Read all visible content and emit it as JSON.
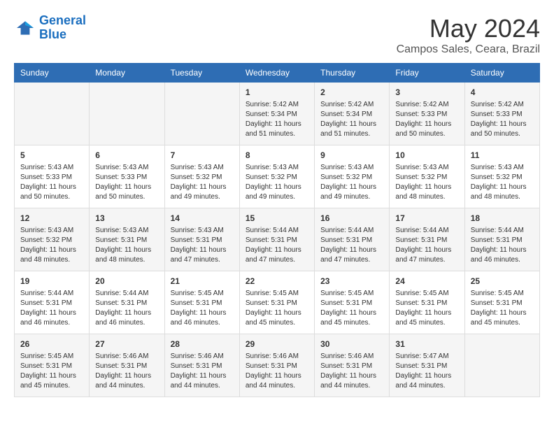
{
  "logo": {
    "line1": "General",
    "line2": "Blue"
  },
  "title": "May 2024",
  "subtitle": "Campos Sales, Ceara, Brazil",
  "days_header": [
    "Sunday",
    "Monday",
    "Tuesday",
    "Wednesday",
    "Thursday",
    "Friday",
    "Saturday"
  ],
  "weeks": [
    [
      {
        "day": "",
        "info": ""
      },
      {
        "day": "",
        "info": ""
      },
      {
        "day": "",
        "info": ""
      },
      {
        "day": "1",
        "info": "Sunrise: 5:42 AM\nSunset: 5:34 PM\nDaylight: 11 hours\nand 51 minutes."
      },
      {
        "day": "2",
        "info": "Sunrise: 5:42 AM\nSunset: 5:34 PM\nDaylight: 11 hours\nand 51 minutes."
      },
      {
        "day": "3",
        "info": "Sunrise: 5:42 AM\nSunset: 5:33 PM\nDaylight: 11 hours\nand 50 minutes."
      },
      {
        "day": "4",
        "info": "Sunrise: 5:42 AM\nSunset: 5:33 PM\nDaylight: 11 hours\nand 50 minutes."
      }
    ],
    [
      {
        "day": "5",
        "info": "Sunrise: 5:43 AM\nSunset: 5:33 PM\nDaylight: 11 hours\nand 50 minutes."
      },
      {
        "day": "6",
        "info": "Sunrise: 5:43 AM\nSunset: 5:33 PM\nDaylight: 11 hours\nand 50 minutes."
      },
      {
        "day": "7",
        "info": "Sunrise: 5:43 AM\nSunset: 5:32 PM\nDaylight: 11 hours\nand 49 minutes."
      },
      {
        "day": "8",
        "info": "Sunrise: 5:43 AM\nSunset: 5:32 PM\nDaylight: 11 hours\nand 49 minutes."
      },
      {
        "day": "9",
        "info": "Sunrise: 5:43 AM\nSunset: 5:32 PM\nDaylight: 11 hours\nand 49 minutes."
      },
      {
        "day": "10",
        "info": "Sunrise: 5:43 AM\nSunset: 5:32 PM\nDaylight: 11 hours\nand 48 minutes."
      },
      {
        "day": "11",
        "info": "Sunrise: 5:43 AM\nSunset: 5:32 PM\nDaylight: 11 hours\nand 48 minutes."
      }
    ],
    [
      {
        "day": "12",
        "info": "Sunrise: 5:43 AM\nSunset: 5:32 PM\nDaylight: 11 hours\nand 48 minutes."
      },
      {
        "day": "13",
        "info": "Sunrise: 5:43 AM\nSunset: 5:31 PM\nDaylight: 11 hours\nand 48 minutes."
      },
      {
        "day": "14",
        "info": "Sunrise: 5:43 AM\nSunset: 5:31 PM\nDaylight: 11 hours\nand 47 minutes."
      },
      {
        "day": "15",
        "info": "Sunrise: 5:44 AM\nSunset: 5:31 PM\nDaylight: 11 hours\nand 47 minutes."
      },
      {
        "day": "16",
        "info": "Sunrise: 5:44 AM\nSunset: 5:31 PM\nDaylight: 11 hours\nand 47 minutes."
      },
      {
        "day": "17",
        "info": "Sunrise: 5:44 AM\nSunset: 5:31 PM\nDaylight: 11 hours\nand 47 minutes."
      },
      {
        "day": "18",
        "info": "Sunrise: 5:44 AM\nSunset: 5:31 PM\nDaylight: 11 hours\nand 46 minutes."
      }
    ],
    [
      {
        "day": "19",
        "info": "Sunrise: 5:44 AM\nSunset: 5:31 PM\nDaylight: 11 hours\nand 46 minutes."
      },
      {
        "day": "20",
        "info": "Sunrise: 5:44 AM\nSunset: 5:31 PM\nDaylight: 11 hours\nand 46 minutes."
      },
      {
        "day": "21",
        "info": "Sunrise: 5:45 AM\nSunset: 5:31 PM\nDaylight: 11 hours\nand 46 minutes."
      },
      {
        "day": "22",
        "info": "Sunrise: 5:45 AM\nSunset: 5:31 PM\nDaylight: 11 hours\nand 45 minutes."
      },
      {
        "day": "23",
        "info": "Sunrise: 5:45 AM\nSunset: 5:31 PM\nDaylight: 11 hours\nand 45 minutes."
      },
      {
        "day": "24",
        "info": "Sunrise: 5:45 AM\nSunset: 5:31 PM\nDaylight: 11 hours\nand 45 minutes."
      },
      {
        "day": "25",
        "info": "Sunrise: 5:45 AM\nSunset: 5:31 PM\nDaylight: 11 hours\nand 45 minutes."
      }
    ],
    [
      {
        "day": "26",
        "info": "Sunrise: 5:45 AM\nSunset: 5:31 PM\nDaylight: 11 hours\nand 45 minutes."
      },
      {
        "day": "27",
        "info": "Sunrise: 5:46 AM\nSunset: 5:31 PM\nDaylight: 11 hours\nand 44 minutes."
      },
      {
        "day": "28",
        "info": "Sunrise: 5:46 AM\nSunset: 5:31 PM\nDaylight: 11 hours\nand 44 minutes."
      },
      {
        "day": "29",
        "info": "Sunrise: 5:46 AM\nSunset: 5:31 PM\nDaylight: 11 hours\nand 44 minutes."
      },
      {
        "day": "30",
        "info": "Sunrise: 5:46 AM\nSunset: 5:31 PM\nDaylight: 11 hours\nand 44 minutes."
      },
      {
        "day": "31",
        "info": "Sunrise: 5:47 AM\nSunset: 5:31 PM\nDaylight: 11 hours\nand 44 minutes."
      },
      {
        "day": "",
        "info": ""
      }
    ]
  ]
}
